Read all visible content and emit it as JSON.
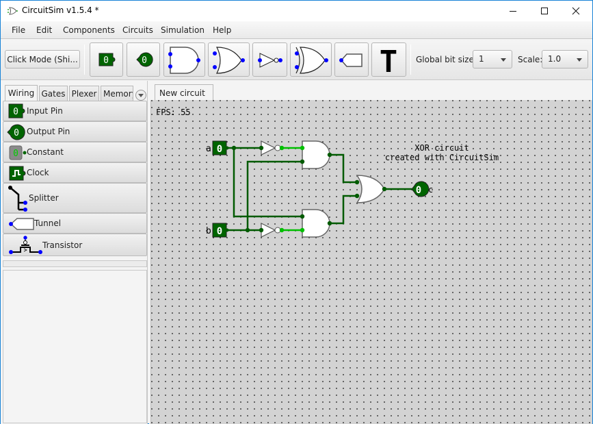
{
  "window": {
    "title": "CircuitSim v1.5.4 *",
    "controls": {
      "minimize": "minimize-icon",
      "maximize": "maximize-icon",
      "close": "close-icon"
    }
  },
  "menu": [
    "File",
    "Edit",
    "Components",
    "Circuits",
    "Simulation",
    "Help"
  ],
  "toolbar": {
    "click_mode_label": "Click Mode (Shi...",
    "tools": [
      {
        "name": "input-pin",
        "value": "0"
      },
      {
        "name": "output-pin",
        "value": "0"
      },
      {
        "name": "and-gate"
      },
      {
        "name": "or-gate"
      },
      {
        "name": "not-gate"
      },
      {
        "name": "xor-gate"
      },
      {
        "name": "tunnel"
      },
      {
        "name": "text",
        "glyph": "T"
      }
    ],
    "global_bit_size_label": "Global bit size:",
    "global_bit_size_value": "1",
    "scale_label": "Scale:",
    "scale_value": "1.0"
  },
  "palette": {
    "tabs": [
      "Wiring",
      "Gates",
      "Plexer",
      "Memory"
    ],
    "active_tab": "Wiring",
    "items": [
      {
        "label": "Input Pin",
        "icon": "input-pin-icon",
        "value": "0"
      },
      {
        "label": "Output Pin",
        "icon": "output-pin-icon",
        "value": "0"
      },
      {
        "label": "Constant",
        "icon": "constant-icon",
        "value": "0"
      },
      {
        "label": "Clock",
        "icon": "clock-icon"
      },
      {
        "label": "Splitter",
        "icon": "splitter-icon"
      },
      {
        "label": "Tunnel",
        "icon": "tunnel-icon"
      },
      {
        "label": "Transistor",
        "icon": "transistor-icon"
      }
    ]
  },
  "circuit_tab": {
    "label": "New circuit",
    "close": "×"
  },
  "canvas": {
    "fps_label": "FPS: 55",
    "note_line1": "XOR circuit",
    "note_line2": "created with CircuitSim",
    "input_a": {
      "label": "a",
      "value": "0"
    },
    "input_b": {
      "label": "b",
      "value": "0"
    },
    "output_c": {
      "label": "c",
      "value": "0"
    },
    "colors": {
      "wire_low": "#005a00",
      "wire_high": "#00bf00",
      "port": "#0000ff",
      "pin_fill": "#006400"
    }
  }
}
